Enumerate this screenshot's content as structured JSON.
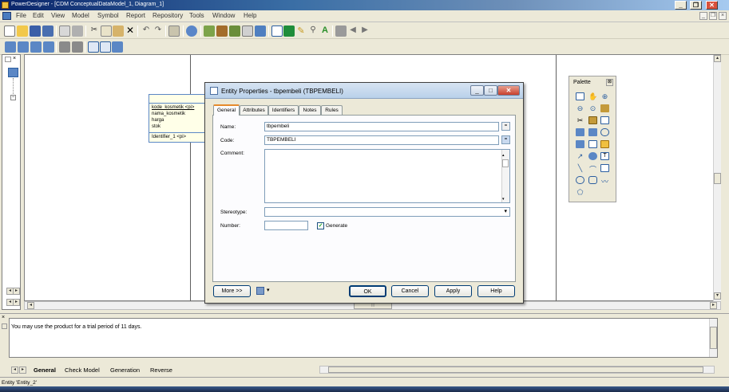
{
  "window": {
    "title": "PowerDesigner - [CDM ConceptualDataModel_1, Diagram_1]"
  },
  "menubar": {
    "items": [
      "File",
      "Edit",
      "View",
      "Model",
      "Symbol",
      "Report",
      "Repository",
      "Tools",
      "Window",
      "Help"
    ]
  },
  "entity": {
    "attributes": [
      "kode_kosmetik  <pi>",
      "nama_kosmetik",
      "harga",
      "stok"
    ],
    "identifier": "Identifier_1  <pi>"
  },
  "dialog": {
    "title": "Entity Properties - tbpembeli (TBPEMBELI)",
    "tabs": [
      "General",
      "Attributes",
      "Identifiers",
      "Notes",
      "Rules"
    ],
    "active_tab": "General",
    "name_label": "Name:",
    "name_value": "tbpembeli",
    "code_label": "Code:",
    "code_value": "TBPEMBELI",
    "comment_label": "Comment:",
    "stereotype_label": "Stereotype:",
    "number_label": "Number:",
    "generate_label": "Generate",
    "generate_checked": true,
    "more_label": "More >>",
    "ok_label": "OK",
    "cancel_label": "Cancel",
    "apply_label": "Apply",
    "help_label": "Help"
  },
  "palette": {
    "title": "Palette"
  },
  "output": {
    "message": "You may use the product for a trial period of 11 days.",
    "tabs": [
      "General",
      "Check Model",
      "Generation",
      "Reverse"
    ]
  },
  "status": {
    "text": "Entity 'Entity_2'"
  },
  "colors": {
    "accent": "#0a246a",
    "entity_border": "#5b87c5",
    "entity_fill": "#ffffe8"
  }
}
